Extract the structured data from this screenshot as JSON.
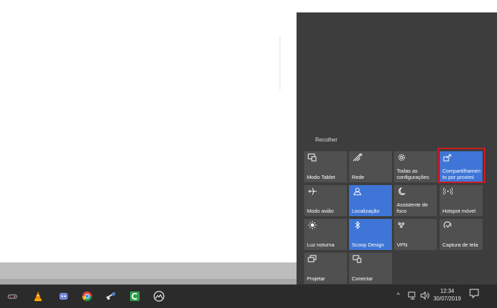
{
  "action_center": {
    "collapse_label": "Recolher",
    "tiles": [
      {
        "id": "tablet",
        "label": "Modo Tablet",
        "active": false,
        "icon": "tablet-mode-icon"
      },
      {
        "id": "network",
        "label": "Rede",
        "active": false,
        "icon": "network-icon"
      },
      {
        "id": "settings",
        "label": "Todas as configurações",
        "active": false,
        "icon": "gear-icon"
      },
      {
        "id": "nearby",
        "label": "Compartilhamento por proximi",
        "active": true,
        "icon": "nearby-share-icon"
      },
      {
        "id": "airplane",
        "label": "Modo avião",
        "active": false,
        "icon": "airplane-icon"
      },
      {
        "id": "location",
        "label": "Localização",
        "active": true,
        "icon": "location-icon"
      },
      {
        "id": "focus",
        "label": "Assistente de foco",
        "active": false,
        "icon": "moon-icon"
      },
      {
        "id": "hotspot",
        "label": "Hotspot móvel",
        "active": false,
        "icon": "hotspot-icon"
      },
      {
        "id": "nightlight",
        "label": "Luz noturna",
        "active": false,
        "icon": "sun-icon"
      },
      {
        "id": "bluetooth",
        "label": "Scoop Design",
        "active": true,
        "icon": "bluetooth-icon"
      },
      {
        "id": "vpn",
        "label": "VPN",
        "active": false,
        "icon": "vpn-icon"
      },
      {
        "id": "screenshot",
        "label": "Captura de tela",
        "active": false,
        "icon": "screen-snip-icon"
      },
      {
        "id": "project",
        "label": "Projetar",
        "active": false,
        "icon": "project-icon"
      },
      {
        "id": "connect",
        "label": "Conectar",
        "active": false,
        "icon": "connect-icon"
      }
    ]
  },
  "taskbar": {
    "apps": [
      "game-controller-icon",
      "vlc-icon",
      "discord-icon",
      "chrome-icon",
      "steam-icon",
      "camtasia-icon",
      "mountain-app-icon"
    ],
    "tray_chevron": "^",
    "time": "12:34",
    "date": "30/07/2019"
  },
  "colors": {
    "active_tile": "#3f75d6",
    "inactive_tile": "#505050",
    "panel": "#3d3d3d",
    "taskbar": "#2b2b2b",
    "highlight": "#d11a22"
  }
}
